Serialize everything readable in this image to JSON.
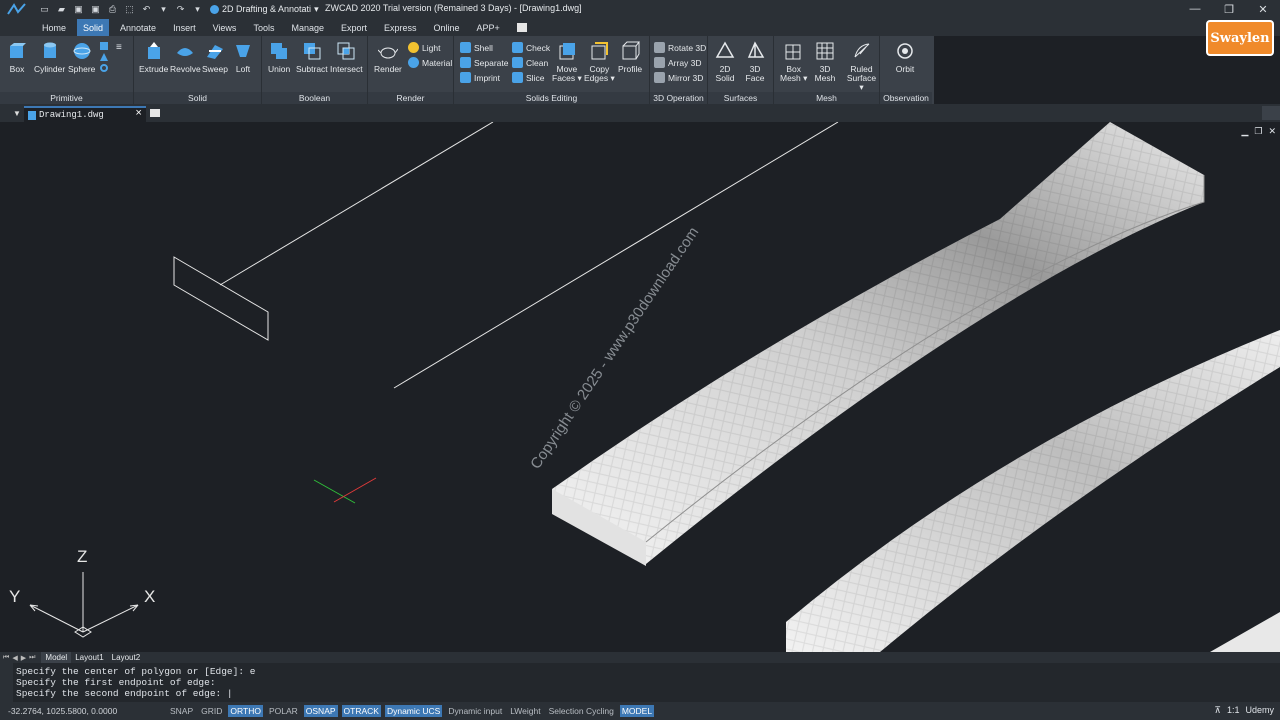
{
  "titlebar": {
    "workspace": "2D Drafting & Annotati",
    "title": "ZWCAD 2020 Trial version (Remained 3 Days) - [Drawing1.dwg]"
  },
  "tabs": [
    "Home",
    "Solid",
    "Annotate",
    "Insert",
    "Views",
    "Tools",
    "Manage",
    "Export",
    "Express",
    "Online",
    "APP+"
  ],
  "active_tab": "Solid",
  "ribbon": {
    "primitive": {
      "title": "Primitive",
      "box": "Box",
      "cylinder": "Cylinder",
      "sphere": "Sphere"
    },
    "solid": {
      "title": "Solid",
      "extrude": "Extrude",
      "revolve": "Revolve",
      "sweep": "Sweep",
      "loft": "Loft"
    },
    "boolean": {
      "title": "Boolean",
      "union": "Union",
      "subtract": "Subtract",
      "intersect": "Intersect"
    },
    "render": {
      "title": "Render",
      "render": "Render",
      "light": "Light",
      "material": "Material"
    },
    "solids_editing": {
      "title": "Solids Editing",
      "shell": "Shell",
      "separate": "Separate",
      "imprint": "Imprint",
      "check": "Check",
      "clean": "Clean",
      "slice": "Slice",
      "move_faces_1": "Move",
      "move_faces_2": "Faces ▾",
      "copy_edges_1": "Copy",
      "copy_edges_2": "Edges ▾",
      "profile": "Profile"
    },
    "op3d": {
      "title": "3D Operation",
      "rotate3d": "Rotate 3D",
      "array3d": "Array 3D",
      "mirror3d": "Mirror 3D"
    },
    "surfaces": {
      "title": "Surfaces",
      "solid2d_1": "2D",
      "solid2d_2": "Solid",
      "face3d_1": "3D",
      "face3d_2": "Face"
    },
    "mesh": {
      "title": "Mesh",
      "boxmesh_1": "Box",
      "boxmesh_2": "Mesh ▾",
      "mesh3d_1": "3D",
      "mesh3d_2": "Mesh",
      "ruled_1": "Ruled",
      "ruled_2": "Surface ▾"
    },
    "observation": {
      "title": "Observation",
      "orbit": "Orbit"
    }
  },
  "doc_tab": "Drawing1.dwg",
  "canvas": {
    "watermark": "Copyright © 2025 - www.p30download.com",
    "ucs_z": "Z",
    "ucs_y": "Y",
    "ucs_x": "X"
  },
  "layout_tabs": [
    "Model",
    "Layout1",
    "Layout2"
  ],
  "command_lines": [
    "Specify the center of polygon or [Edge]: e",
    "Specify the first endpoint of edge:",
    "Specify the second endpoint of edge: |"
  ],
  "status": {
    "coords": "-32.2764, 1025.5800, 0.0000",
    "buttons": [
      {
        "label": "SNAP",
        "on": false
      },
      {
        "label": "GRID",
        "on": false
      },
      {
        "label": "ORTHO",
        "on": true
      },
      {
        "label": "POLAR",
        "on": false
      },
      {
        "label": "OSNAP",
        "on": true
      },
      {
        "label": "OTRACK",
        "on": true
      },
      {
        "label": "Dynamic UCS",
        "on": true
      },
      {
        "label": "Dynamic input",
        "on": false
      },
      {
        "label": "LWeight",
        "on": false
      },
      {
        "label": "Selection Cycling",
        "on": false
      },
      {
        "label": "MODEL",
        "on": true
      }
    ],
    "scale": "1:1",
    "brand": "Udemy"
  },
  "badge": "Swaylen",
  "colors": {
    "accent": "#3d78b4",
    "background": "#1d2025",
    "ribbon": "#3b4149"
  }
}
